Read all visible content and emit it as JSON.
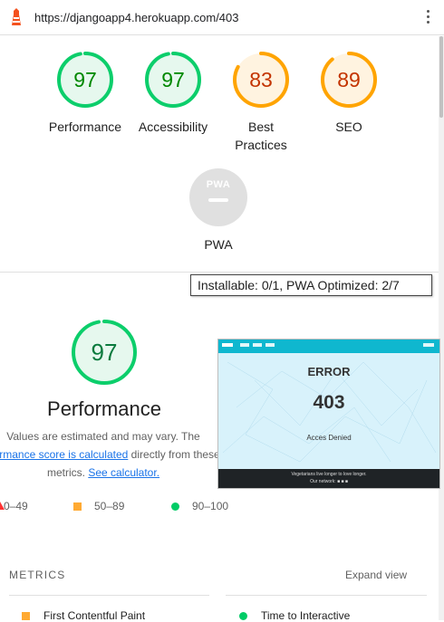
{
  "browser": {
    "url": "https://djangoapp4.herokuapp.com/403"
  },
  "categories": [
    {
      "name": "Performance",
      "score": 97,
      "color": "#0cce6b",
      "text_color": "#008800"
    },
    {
      "name": "Accessibility",
      "score": 97,
      "color": "#0cce6b",
      "text_color": "#008800"
    },
    {
      "name": "Best Practices",
      "score": 83,
      "color": "#ffa400",
      "text_color": "#c33300"
    },
    {
      "name": "SEO",
      "score": 89,
      "color": "#ffa400",
      "text_color": "#c33300"
    }
  ],
  "pwa": {
    "badge": "PWA",
    "label": "PWA",
    "tooltip": "Installable: 0/1, PWA Optimized: 2/7"
  },
  "performance": {
    "score": 97,
    "title": "Performance",
    "desc_line1": "Values are estimated and may vary. The",
    "desc_link1": "rformance score is calculated",
    "desc_line2_rest": " directly from these",
    "desc_line3_pre": "metrics. ",
    "desc_link2": "See calculator."
  },
  "screenshot": {
    "error": "ERROR",
    "code": "403",
    "denied": "Acces Denied",
    "footer_line1": "Vegetarians live longer to love longer.",
    "footer_line2": "Our network: ■ ■ ■"
  },
  "legend": {
    "fail": "0–49",
    "average": "50–89",
    "pass": "90–100"
  },
  "metrics": {
    "heading": "METRICS",
    "expand": "Expand view",
    "items": [
      "First Contentful Paint",
      "Time to Interactive"
    ]
  },
  "colors": {
    "pass": "#0cce6b",
    "average": "#ffa400",
    "fail": "#ff3333",
    "link": "#1a73e8"
  }
}
